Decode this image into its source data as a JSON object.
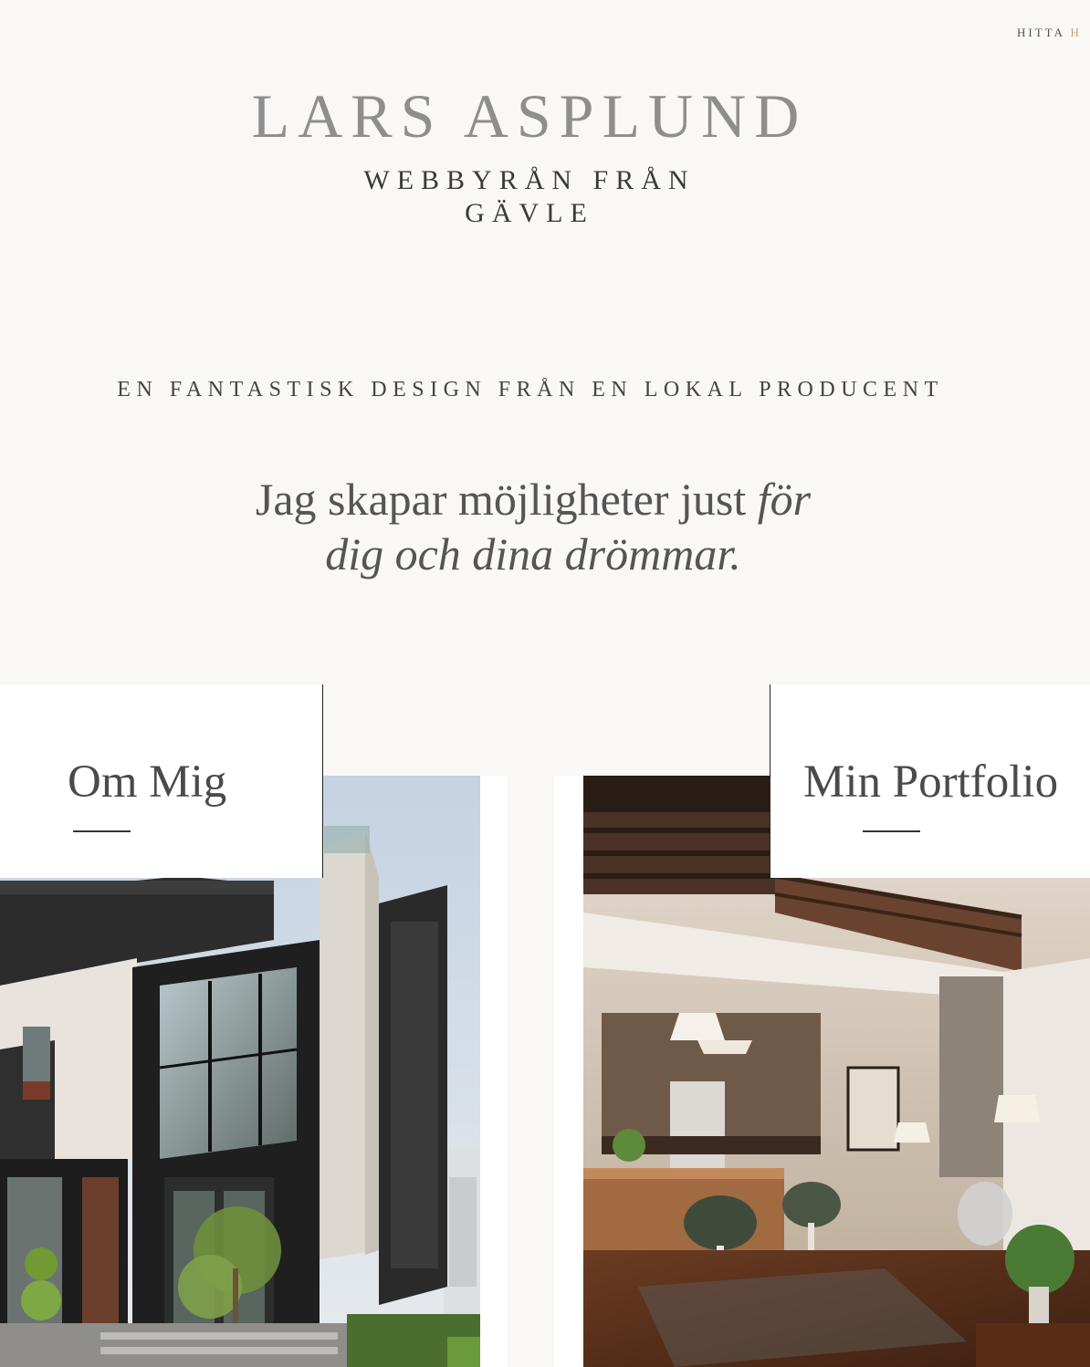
{
  "nav": {
    "text": "HITTA",
    "accent": "H"
  },
  "header": {
    "brand": "LARS ASPLUND",
    "tagline_line1": "WEBBYRÅN FRÅN",
    "tagline_line2": "GÄVLE"
  },
  "hero": {
    "slogan": "EN FANTASTISK DESIGN FRÅN EN LOKAL PRODUCENT",
    "headline_plain": "Jag skapar möjligheter just ",
    "headline_italic_1": "för",
    "headline_italic_2": "dig och dina drömmar."
  },
  "cards": [
    {
      "title": "Om Mig",
      "image": "modern-house-exterior"
    },
    {
      "title": "Min Portfolio",
      "image": "interior-kitchen-living-room"
    }
  ],
  "colors": {
    "background": "#f9f8f6",
    "accent": "#c9a26a",
    "brand": "#8e8e8e"
  }
}
